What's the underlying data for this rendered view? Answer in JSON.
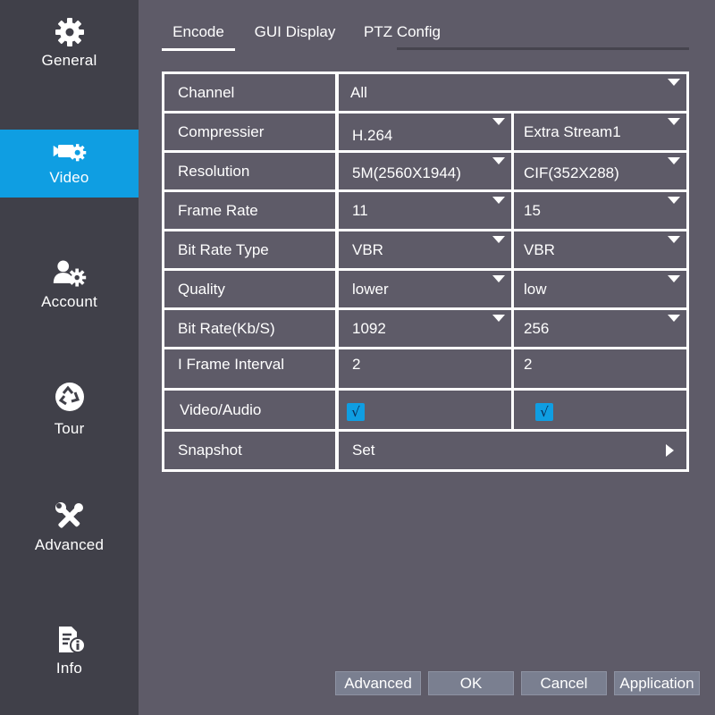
{
  "sidebar": {
    "items": [
      {
        "label": "General",
        "icon": "gear-icon"
      },
      {
        "label": "Video",
        "icon": "video-camera-gear-icon",
        "active": true
      },
      {
        "label": "Account",
        "icon": "users-gear-icon"
      },
      {
        "label": "Tour",
        "icon": "recycle-icon"
      },
      {
        "label": "Advanced",
        "icon": "tools-icon"
      },
      {
        "label": "Info",
        "icon": "info-document-icon"
      }
    ]
  },
  "tabs": [
    {
      "label": "Encode",
      "active": true
    },
    {
      "label": "GUI Display"
    },
    {
      "label": "PTZ Config"
    }
  ],
  "encode": {
    "channel": {
      "label": "Channel",
      "value": "All"
    },
    "compressier": {
      "label": "Compressier",
      "main": "H.264",
      "extra": "Extra Stream1"
    },
    "resolution": {
      "label": "Resolution",
      "main": "5M(2560X1944)",
      "extra": "CIF(352X288)"
    },
    "frame_rate": {
      "label": "Frame Rate",
      "main": "11",
      "extra": "15"
    },
    "bit_rate_type": {
      "label": "Bit Rate Type",
      "main": "VBR",
      "extra": "VBR"
    },
    "quality": {
      "label": "Quality",
      "main": "lower",
      "extra": "low"
    },
    "bit_rate": {
      "label": "Bit Rate(Kb/S)",
      "main": "1092",
      "extra": "256"
    },
    "i_frame_interval": {
      "label": "I Frame Interval",
      "main": "2",
      "extra": "2"
    },
    "video_audio": {
      "label": "Video/Audio",
      "main_check": "√",
      "extra_check": "√"
    },
    "snapshot": {
      "label": "Snapshot",
      "value": "Set"
    }
  },
  "buttons": {
    "advanced": "Advanced",
    "ok": "OK",
    "cancel": "Cancel",
    "application": "Application"
  },
  "colors": {
    "accent": "#0f9ee2",
    "sidebar_bg": "#404049",
    "content_bg": "#5e5b68",
    "button_bg": "#7a7f90"
  }
}
